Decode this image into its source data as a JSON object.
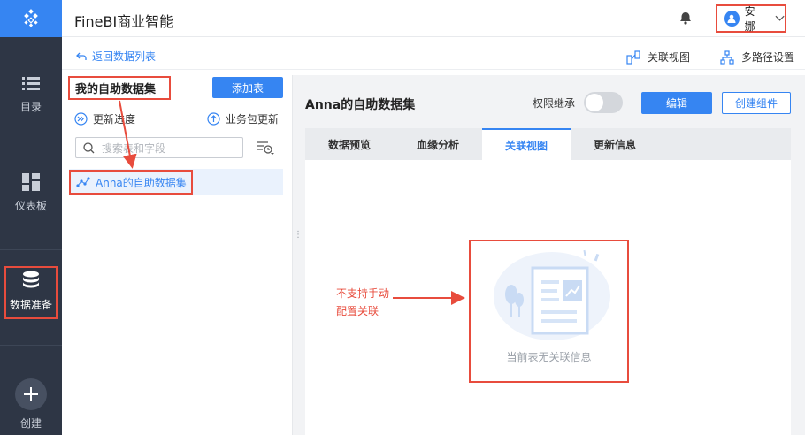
{
  "app": {
    "title": "FineBI商业智能"
  },
  "user": {
    "name": "安娜"
  },
  "sidebar": {
    "items": [
      {
        "label": "目录",
        "icon": "list-icon"
      },
      {
        "label": "仪表板",
        "icon": "dashboard-icon"
      },
      {
        "label": "数据准备",
        "icon": "database-icon"
      },
      {
        "label": "创建",
        "icon": "plus-icon"
      }
    ]
  },
  "subheader": {
    "back_label": "返回数据列表",
    "relation_view_label": "关联视图",
    "multipath_label": "多路径设置"
  },
  "left_panel": {
    "title": "我的自助数据集",
    "add_table_label": "添加表",
    "update_progress_label": "更新进度",
    "package_update_label": "业务包更新",
    "search_placeholder": "搜索表和字段",
    "tree_item": "Anna的自助数据集"
  },
  "right_panel": {
    "title": "Anna的自助数据集",
    "permission_label": "权限继承",
    "permission_inherit": false,
    "edit_label": "编辑",
    "create_component_label": "创建组件",
    "tabs": [
      "数据预览",
      "血缘分析",
      "关联视图",
      "更新信息"
    ],
    "active_tab": 2,
    "empty_text": "当前表无关联信息"
  },
  "annotation": {
    "line1": "不支持手动",
    "line2": "配置关联"
  },
  "colors": {
    "accent": "#3685f2",
    "highlight": "#e84c3d",
    "nav_bg": "#2e3645"
  }
}
